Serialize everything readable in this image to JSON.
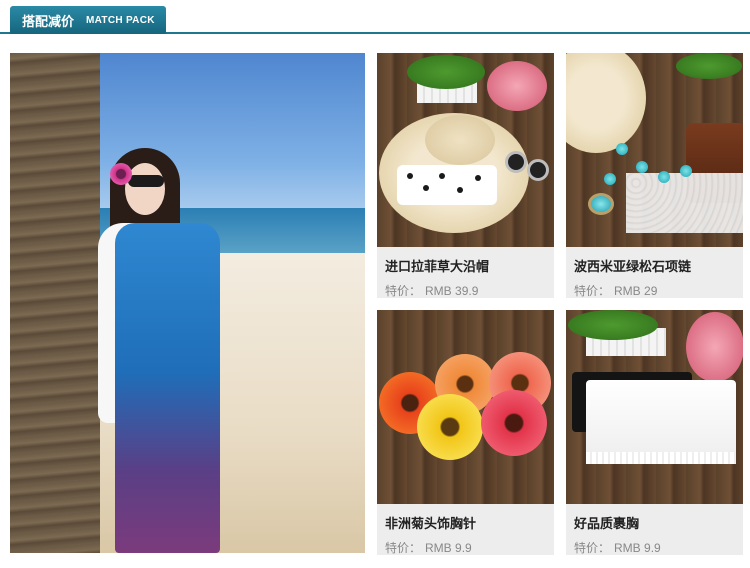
{
  "header": {
    "title_cn": "搭配减价",
    "title_en": "MATCH PACK"
  },
  "hero": {
    "icon": "beach-model-photo"
  },
  "products": [
    {
      "name": "进口拉菲草大沿帽",
      "price_label": "特价：",
      "price": "RMB 39.9",
      "icon": "straw-hat-photo"
    },
    {
      "name": "波西米亚绿松石项链",
      "price_label": "特价：",
      "price": "RMB 29",
      "icon": "turquoise-necklace-photo"
    },
    {
      "name": "非洲菊头饰胸针",
      "price_label": "特价：",
      "price": "RMB 9.9",
      "icon": "gerbera-brooch-photo"
    },
    {
      "name": "好品质裹胸",
      "price_label": "特价：",
      "price": "RMB 9.9",
      "icon": "tube-top-photo"
    }
  ],
  "colors": {
    "header_tab": "#1d7791",
    "card_info_bg": "#ededed",
    "title_text": "#222222",
    "price_text": "#888888"
  }
}
